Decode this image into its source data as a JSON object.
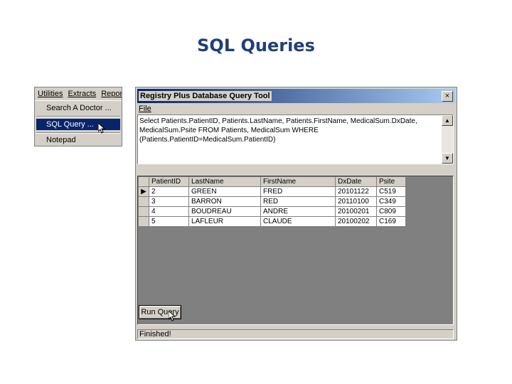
{
  "slide": {
    "title": "SQL Queries"
  },
  "menu": {
    "bar": [
      "Utilities",
      "Extracts",
      "Reports"
    ],
    "items": [
      "Search A Doctor ...",
      "SQL Query ...",
      "Notepad"
    ]
  },
  "window": {
    "title": "Registry Plus Database Query Tool",
    "close": "×",
    "menu_file": "File",
    "sql": "Select Patients.PatientID, Patients.LastName, Patients.FirstName, MedicalSum.DxDate, MedicalSum.Psite FROM Patients, MedicalSum WHERE (Patients.PatientID=MedicalSum.PatientID)",
    "columns": [
      "PatientID",
      "LastName",
      "FirstName",
      "DxDate",
      "Psite"
    ],
    "rows": [
      [
        "2",
        "GREEN",
        "FRED",
        "20101122",
        "C519"
      ],
      [
        "3",
        "BARRON",
        "RED",
        "20110100",
        "C349"
      ],
      [
        "4",
        "BOUDREAU",
        "ANDRE",
        "20100201",
        "C809"
      ],
      [
        "5",
        "LAFLEUR",
        "CLAUDE",
        "20100202",
        "C169"
      ]
    ],
    "row_indicator": "▶",
    "run_button": "Run Query",
    "status": "Finished!"
  }
}
